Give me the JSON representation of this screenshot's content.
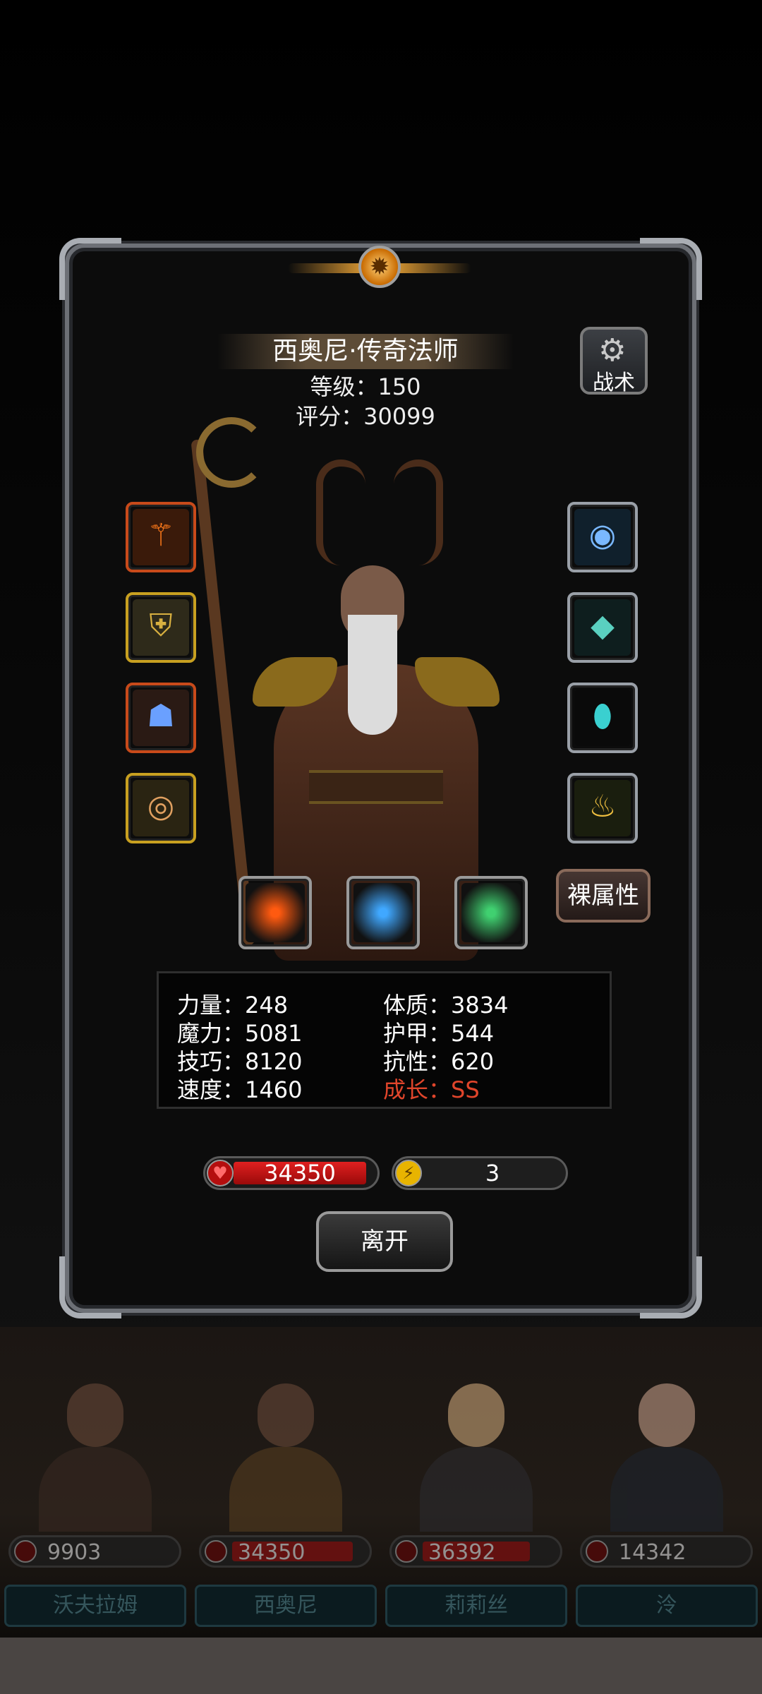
{
  "hero": {
    "name": "西奥尼·传奇法师",
    "level": "等级：150",
    "score": "评分：30099"
  },
  "buttons": {
    "tactics": "战术",
    "base_attributes": "裸属性",
    "leave": "离开"
  },
  "equipment_left": [
    {
      "icon": "fire-staff-icon",
      "glyph": "⚚",
      "color": "#ff7a1a",
      "frame": "#c84a1a"
    },
    {
      "icon": "armor-icon",
      "glyph": "⛨",
      "color": "#d8b040",
      "frame": "#c8a020"
    },
    {
      "icon": "dragon-helm-icon",
      "glyph": "☗",
      "color": "#6aa0ff",
      "frame": "#c84a1a"
    },
    {
      "icon": "ring-icon",
      "glyph": "◎",
      "color": "#e0a060",
      "frame": "#c8a020"
    }
  ],
  "equipment_right": [
    {
      "icon": "water-amulet-icon",
      "glyph": "◉",
      "color": "#7ab8ff"
    },
    {
      "icon": "crystal-orb-icon",
      "glyph": "◆",
      "color": "#5ad0c0"
    },
    {
      "icon": "gem-icon",
      "glyph": "⬮",
      "color": "#3ad0d0"
    },
    {
      "icon": "lantern-icon",
      "glyph": "♨",
      "color": "#f0c040"
    }
  ],
  "skills": [
    {
      "icon": "fire-blast-icon",
      "color": "#ff5a10"
    },
    {
      "icon": "ice-slash-icon",
      "color": "#40a8ff"
    },
    {
      "icon": "nature-light-icon",
      "color": "#40d070"
    }
  ],
  "stats": {
    "strength": "力量：248",
    "constitution": "体质：3834",
    "magic": "魔力：5081",
    "armor": "护甲：544",
    "skill": "技巧：8120",
    "resistance": "抗性：620",
    "speed": "速度：1460",
    "growth": "成长：SS"
  },
  "hp": "34350",
  "energy": "3",
  "colors": {
    "accent_gold": "#ffb13a",
    "growth_red": "#e0452b",
    "hp_red": "#e02020"
  },
  "team": [
    {
      "name": "沃夫拉姆",
      "hp": "9903",
      "hp_fill": 0.0
    },
    {
      "name": "西奥尼",
      "hp": "34350",
      "hp_fill": 0.9
    },
    {
      "name": "莉莉丝",
      "hp": "36392",
      "hp_fill": 0.8
    },
    {
      "name": "泠",
      "hp": "14342",
      "hp_fill": 0.0
    }
  ]
}
